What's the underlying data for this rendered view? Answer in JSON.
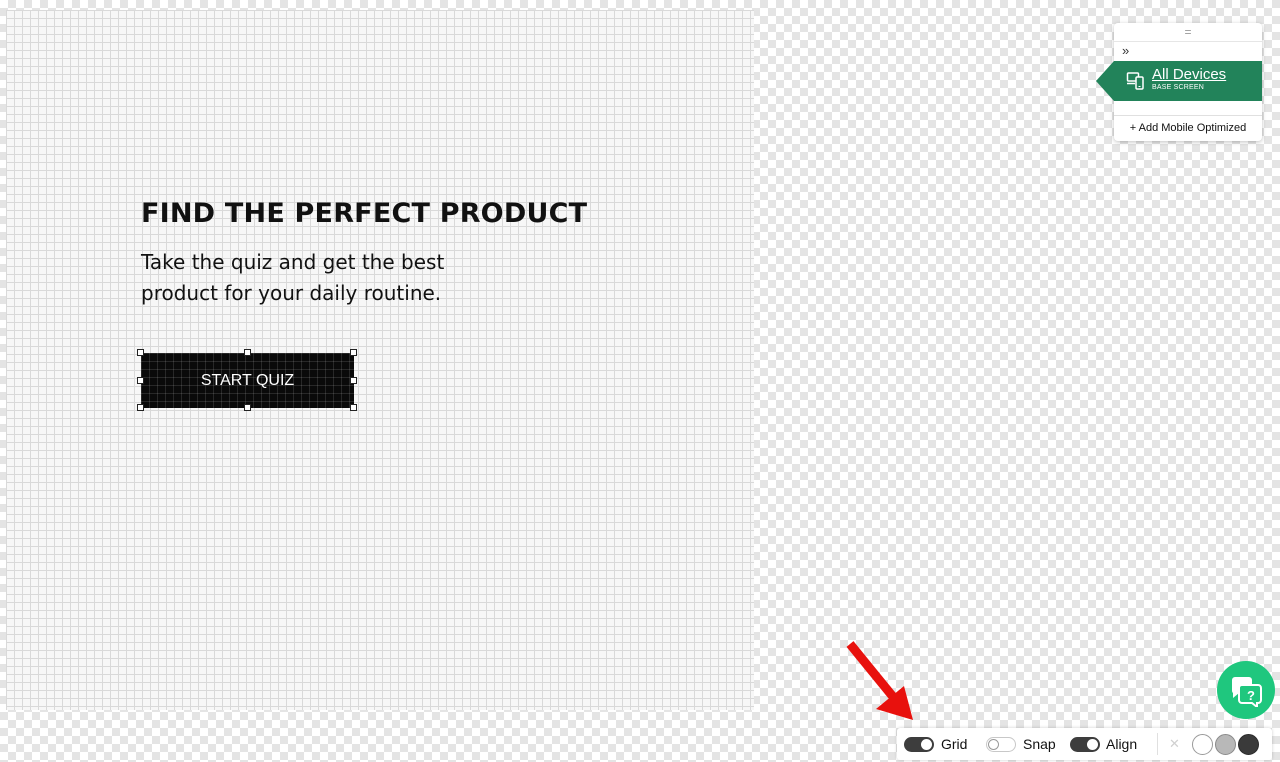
{
  "canvas": {
    "headline": "FIND THE PERFECT PRODUCT",
    "subheadline": "Take the quiz and get the best product for your daily routine.",
    "cta_label": "START QUIZ"
  },
  "device_panel": {
    "drag_glyph": "=",
    "expand_glyph": "»",
    "active_device": {
      "title": "All Devices",
      "subtitle": "BASE SCREEN",
      "icon": "devices-icon",
      "color": "#22835a"
    },
    "add_label": "+ Add Mobile Optimized"
  },
  "toolbar": {
    "toggles": [
      {
        "label": "Grid",
        "state": "on"
      },
      {
        "label": "Snap",
        "state": "off"
      },
      {
        "label": "Align",
        "state": "on"
      }
    ],
    "clear_glyph": "✕",
    "background_swatches": [
      {
        "name": "white",
        "color": "#ffffff"
      },
      {
        "name": "gray",
        "color": "#b8b8b8"
      },
      {
        "name": "dark",
        "color": "#3a3a3a"
      }
    ]
  },
  "help_button": {
    "icon": "chat-help-icon",
    "glyph": "?",
    "color": "#1fc77e"
  },
  "annotation": {
    "icon": "red-arrow-icon",
    "color": "#e8110d"
  }
}
